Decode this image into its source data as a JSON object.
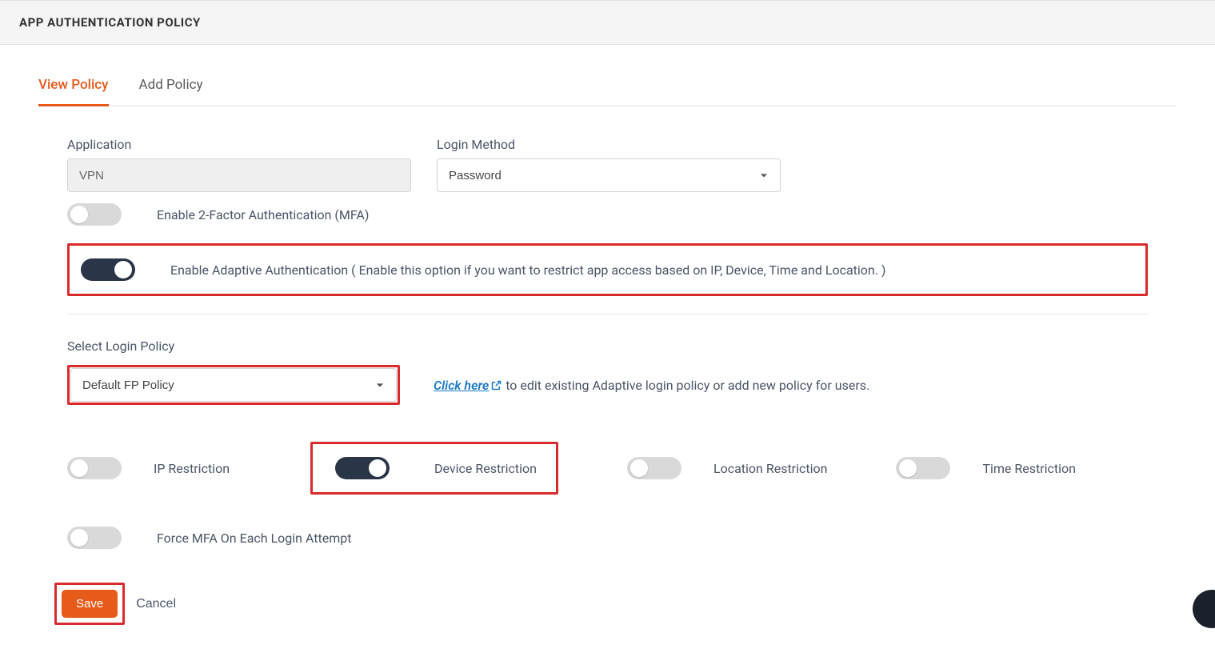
{
  "header": {
    "title": "APP AUTHENTICATION POLICY"
  },
  "tabs": {
    "view": "View Policy",
    "add": "Add Policy"
  },
  "form": {
    "application_label": "Application",
    "application_value": "VPN",
    "login_method_label": "Login Method",
    "login_method_value": "Password",
    "mfa_toggle_label": "Enable 2-Factor Authentication (MFA)",
    "adaptive_toggle_label": "Enable Adaptive Authentication ( Enable this option if you want to restrict app access based on IP, Device, Time and Location. )",
    "select_login_policy_label": "Select Login Policy",
    "select_login_policy_value": "Default FP Policy",
    "click_here_label": "Click here",
    "click_here_tail": " to edit existing Adaptive login policy or add new policy for users.",
    "restrictions": {
      "ip": "IP Restriction",
      "device": "Device Restriction",
      "location": "Location Restriction",
      "time": "Time Restriction"
    },
    "force_mfa_label": "Force MFA On Each Login Attempt",
    "save_label": "Save",
    "cancel_label": "Cancel"
  }
}
